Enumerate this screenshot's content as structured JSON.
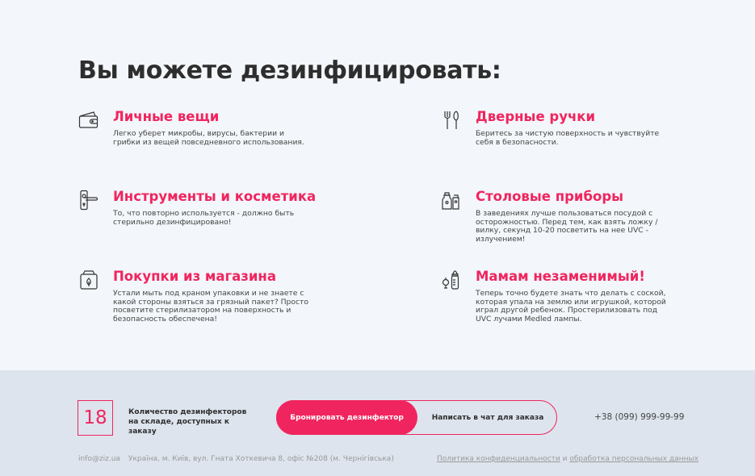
{
  "title": "Вы можете дезинфицировать:",
  "features": [
    {
      "icon": "wallet-icon",
      "title": "Личные вещи",
      "desc": "Легко уберет микробы, вирусы, бактерии и грибки из вещей повседневного использования."
    },
    {
      "icon": "cutlery-icon",
      "title": "Дверные ручки",
      "desc": "Беритесь за чистую поверхность и чувствуйте себя в безопасности."
    },
    {
      "icon": "door-handle-icon",
      "title": "Инструменты и косметика",
      "desc": "То, что повторно используется - должно быть стерильно дезинфицировано!"
    },
    {
      "icon": "cosmetics-icon",
      "title": "Столовые приборы",
      "desc": "В заведениях лучше пользоваться посудой с осторожностью. Перед тем, как взять ложку / вилку, секунд 10-20 посветить на нее UVC - излучением!"
    },
    {
      "icon": "shopping-bag-icon",
      "title": "Покупки из магазина",
      "desc": "Устали мыть под краном упаковки и не знаете с какой стороны взяться за грязный пакет? Просто посветите стерилизатором на поверхность и безопасность обеспечена!"
    },
    {
      "icon": "baby-bottle-icon",
      "title": "Мамам незаменимый!",
      "desc": "Теперь точно будете знать что делать с соской, которая упала на землю или игрушкой, которой играл другой ребенок. Простерилизовать под UVC лучами Medled лампы."
    }
  ],
  "footer": {
    "counter": "18",
    "counter_text": "Количество дезинфекторов на складе, доступных к заказу",
    "primary_button": "Бронировать дезинфектор",
    "secondary_button": "Написать в чат для заказа",
    "phone": "+38 (099) 999-99-99",
    "email": "info@ziz.ua",
    "address": "Україна, м. Київ, вул. Гната Хоткевича 8, офіс №208 (м. Чернігівська)",
    "policy_link": "Политика конфиденциальности",
    "policy_and": " и ",
    "data_link": "обработка персональных данных"
  },
  "colors": {
    "accent": "#f0255f",
    "background": "#f3f6fa",
    "footer_background": "#dde4ed"
  }
}
